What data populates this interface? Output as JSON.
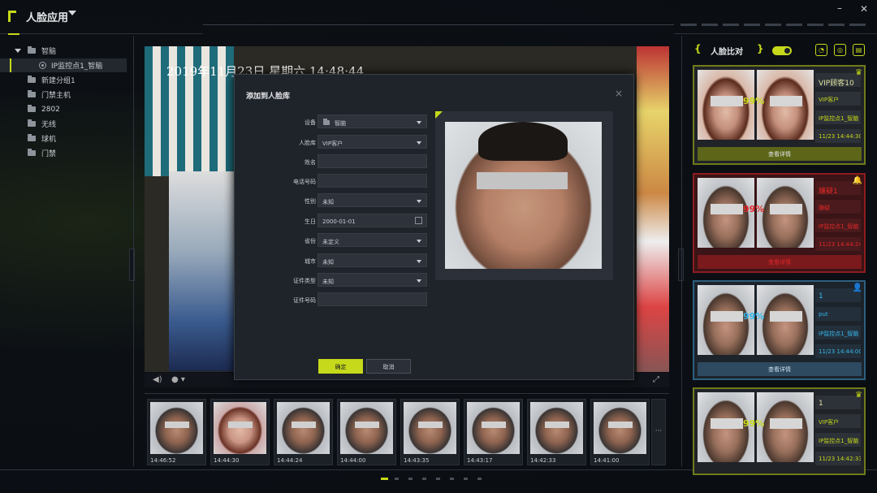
{
  "app": {
    "title": "人脸应用",
    "window_min": "–",
    "window_close": "✕"
  },
  "tree": [
    {
      "label": "智脑",
      "kind": "root"
    },
    {
      "label": "IP监控点1_智脑",
      "kind": "camera",
      "selected": true
    },
    {
      "label": "新建分组1",
      "kind": "folder"
    },
    {
      "label": "门禁主机",
      "kind": "folder"
    },
    {
      "label": "2802",
      "kind": "folder"
    },
    {
      "label": "无线",
      "kind": "folder"
    },
    {
      "label": "球机",
      "kind": "folder"
    },
    {
      "label": "门禁",
      "kind": "folder"
    }
  ],
  "video": {
    "timestamp": "2019年11月23日  星期六  14:48:44"
  },
  "dialog": {
    "title": "添加到人脸库",
    "close": "×",
    "fields": [
      {
        "label": "设备",
        "value": "智脑",
        "type": "dropdown",
        "icon": "folder"
      },
      {
        "label": "人脸库",
        "value": "VIP客户",
        "type": "dropdown"
      },
      {
        "label": "姓名",
        "value": "",
        "type": "text"
      },
      {
        "label": "电话号码",
        "value": "",
        "type": "text"
      },
      {
        "label": "性别",
        "value": "未知",
        "type": "dropdown"
      },
      {
        "label": "生日",
        "value": "2000-01-01",
        "type": "date"
      },
      {
        "label": "省份",
        "value": "未定义",
        "type": "dropdown"
      },
      {
        "label": "城市",
        "value": "未知",
        "type": "dropdown"
      },
      {
        "label": "证件类型",
        "value": "未知",
        "type": "dropdown"
      },
      {
        "label": "证件号码",
        "value": "",
        "type": "text"
      }
    ],
    "ok": "确定",
    "cancel": "取消"
  },
  "thumbnails": [
    {
      "time": "14:46:52",
      "gender": "m"
    },
    {
      "time": "14:44:30",
      "gender": "f"
    },
    {
      "time": "14:44:24",
      "gender": "m"
    },
    {
      "time": "14:44:00",
      "gender": "m"
    },
    {
      "time": "14:43:35",
      "gender": "m"
    },
    {
      "time": "14:43:17",
      "gender": "m"
    },
    {
      "time": "14:42:33",
      "gender": "m"
    },
    {
      "time": "14:41:00",
      "gender": "m"
    }
  ],
  "thumb_more": "···",
  "right_panel": {
    "title": "人脸比对",
    "bracket_left": "{",
    "bracket_right": "}",
    "cards": [
      {
        "theme": "green",
        "score": "99%",
        "name": "VIP顾客10",
        "group": "VIP客户",
        "camera": "IP监控点1_智脑",
        "time": "11/23 14:44:30",
        "button": "查看详情",
        "badge": "crown",
        "left_female": true,
        "right_female": true
      },
      {
        "theme": "red",
        "score": "99%",
        "name": "嫌疑1",
        "group": "嫌疑",
        "camera": "IP监控点1_智脑",
        "time": "11/23 14:44:24",
        "button": "查看详情",
        "badge": "bell",
        "left_female": false,
        "right_female": false
      },
      {
        "theme": "blue",
        "score": "99%",
        "name": "1",
        "group": "put",
        "camera": "IP监控点1_智脑",
        "time": "11/23 14:44:00",
        "button": "查看详情",
        "badge": "person",
        "left_female": false,
        "right_female": false
      },
      {
        "theme": "green",
        "score": "99%",
        "name": "1",
        "group": "VIP客户",
        "camera": "IP监控点1_智脑",
        "time": "11/23 14:42:33",
        "button": "",
        "badge": "crown",
        "left_female": false,
        "right_female": false
      }
    ]
  },
  "colors": {
    "accent": "#c6d91a",
    "alert": "#e02828",
    "info": "#34b6ea"
  }
}
